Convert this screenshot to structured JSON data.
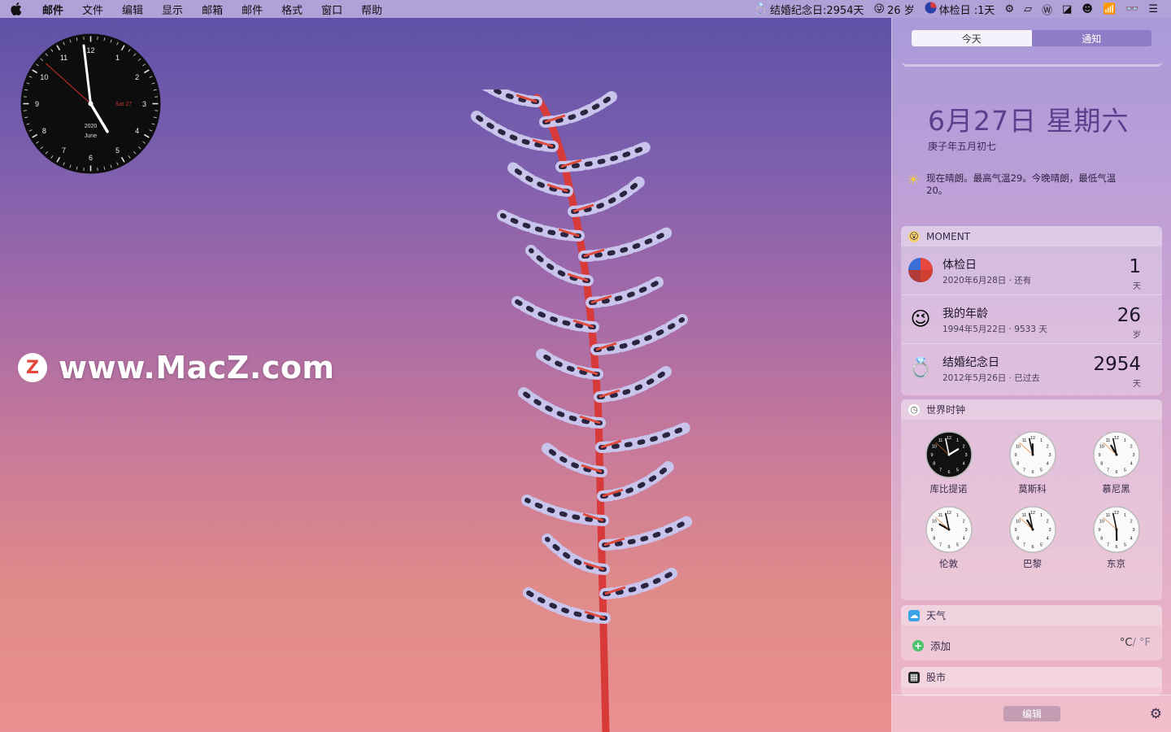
{
  "menubar": {
    "apple_icon": "apple-logo-icon",
    "items": [
      "邮件",
      "文件",
      "编辑",
      "显示",
      "邮箱",
      "邮件",
      "格式",
      "窗口",
      "帮助"
    ],
    "status": {
      "anniversary": "结婚纪念日:2954天",
      "age": "26 岁",
      "checkup": "体检日 :1天"
    },
    "icons": [
      "ring-icon",
      "emoji-icon",
      "globe-icon",
      "gear-icon",
      "drive-icon",
      "word-icon",
      "messenger-icon",
      "smile-icon",
      "wifi-icon",
      "glasses-icon",
      "list-icon"
    ]
  },
  "desktop_clock": {
    "numbers": [
      "12",
      "1",
      "2",
      "3",
      "4",
      "5",
      "6",
      "7",
      "8",
      "9",
      "10",
      "11"
    ],
    "date_label": "Sat 27",
    "year": "2020",
    "month": "June",
    "hour": 4,
    "minute": 58,
    "second": 52
  },
  "watermark": {
    "logo_letter": "Z",
    "text": "www.MacZ.com"
  },
  "notification_center": {
    "tabs": [
      "今天",
      "通知"
    ],
    "active_tab": 0,
    "date": "6月27日 星期六",
    "lunar_date": "庚子年五月初七",
    "weather_summary": "现在晴朗。最高气温29。今晚晴朗，最低气温20。",
    "moment": {
      "title": "MOMENT",
      "items": [
        {
          "name": "体检日",
          "sub": "2020年6月28日 · 还有",
          "value": "1",
          "unit": "天",
          "icon": "pie-chart-icon"
        },
        {
          "name": "我的年龄",
          "sub": "1994年5月22日 · 9533 天",
          "value": "26",
          "unit": "岁",
          "icon": "wink-emoji-icon"
        },
        {
          "name": "结婚纪念日",
          "sub": "2012年5月26日 · 已过去",
          "value": "2954",
          "unit": "天",
          "icon": "ring-icon"
        }
      ]
    },
    "world_clock": {
      "title": "世界时钟",
      "cities": [
        {
          "city": "库比提诺",
          "hour": 1,
          "minute": 58,
          "dark": true
        },
        {
          "city": "莫斯科",
          "hour": 11,
          "minute": 58,
          "dark": false
        },
        {
          "city": "慕尼黑",
          "hour": 10,
          "minute": 58,
          "dark": false
        },
        {
          "city": "伦敦",
          "hour": 9,
          "minute": 58,
          "dark": false
        },
        {
          "city": "巴黎",
          "hour": 10,
          "minute": 58,
          "dark": false
        },
        {
          "city": "东京",
          "hour": 5,
          "minute": 58,
          "dark": false
        }
      ]
    },
    "weather": {
      "title": "天气",
      "add_label": "添加",
      "unit_c": "°C",
      "unit_sep": "/",
      "unit_f": "°F"
    },
    "stocks": {
      "title": "股市"
    },
    "edit_label": "编辑"
  }
}
